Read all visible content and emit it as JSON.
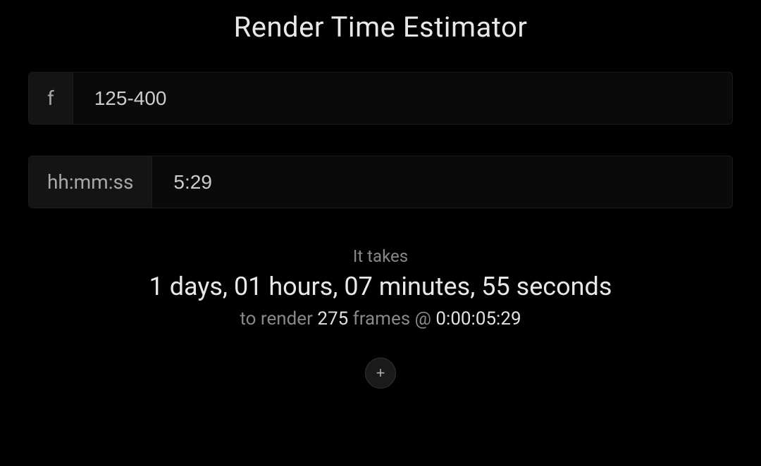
{
  "title": "Render Time Estimator",
  "inputs": {
    "frames": {
      "prefix": "f",
      "value": "125-400"
    },
    "duration": {
      "prefix": "hh:mm:ss",
      "value": "5:29"
    }
  },
  "result": {
    "takes_label": "It takes",
    "total_time": "1 days, 01 hours, 07 minutes, 55 seconds",
    "to_render_label": "to render",
    "frame_count": "275",
    "frames_at_label": "frames @",
    "per_frame_time": "0:00:05:29"
  },
  "add_button_label": "+"
}
